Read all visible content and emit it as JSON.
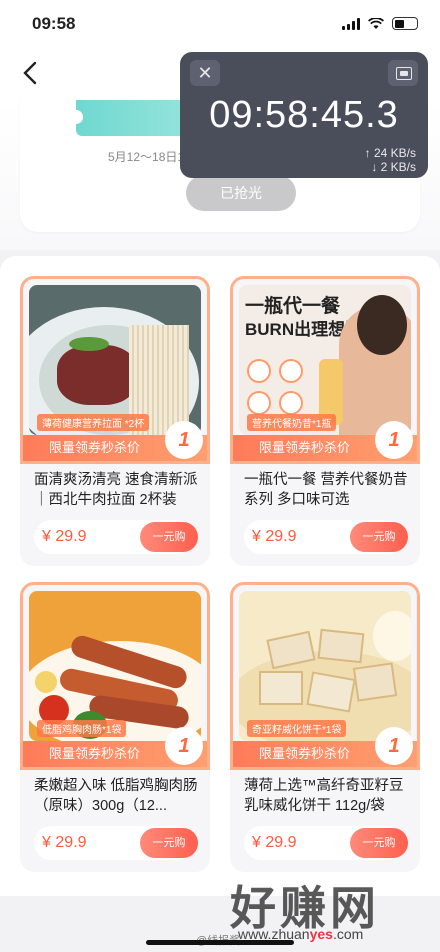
{
  "status": {
    "time": "09:58"
  },
  "coupon": {
    "date_range": "5月12～18日10:00",
    "sold_out_label": "已抢光"
  },
  "timer": {
    "clock": "09:58:45.3",
    "up_speed": "↑ 24 KB/s",
    "down_speed": "↓ 2 KB/s"
  },
  "products": [
    {
      "tag": "薄荷健康营养拉面 *2杯",
      "promo": "限量领券秒杀价",
      "badge": "1",
      "title": "面清爽汤清亮 速食清新派｜西北牛肉拉面 2杯装",
      "price": "¥ 29.9",
      "buy_label": "一元购"
    },
    {
      "tag": "营养代餐奶昔*1瓶",
      "promo": "限量领券秒杀价",
      "badge": "1",
      "title": "一瓶代一餐 营养代餐奶昔系列 多口味可选",
      "price": "¥ 29.9",
      "buy_label": "一元购",
      "headline1": "一瓶代一餐",
      "headline2": "BURN出理想型"
    },
    {
      "tag": "低脂鸡胸肉肠*1袋",
      "promo": "限量领券秒杀价",
      "badge": "1",
      "title": "柔嫩超入味 低脂鸡胸肉肠（原味）300g（12...",
      "price": "¥ 29.9",
      "buy_label": "一元购"
    },
    {
      "tag": "奇亚籽威化饼干*1袋",
      "promo": "限量领券秒杀价",
      "badge": "1",
      "title": "薄荷上选™高纤奇亚籽豆乳味威化饼干 112g/袋",
      "price": "¥ 29.9",
      "buy_label": "一元购"
    }
  ],
  "watermark": {
    "text": "好赚网",
    "url_pre": "www.zhuan",
    "url_mid": "yes",
    "url_post": ".com",
    "weibo": "@线报酱"
  }
}
